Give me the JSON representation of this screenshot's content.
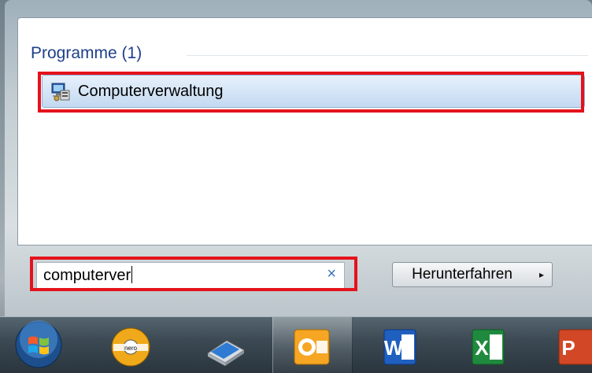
{
  "start_menu": {
    "group_header": "Programme (1)",
    "result_item": {
      "label": "Computerverwaltung",
      "icon": "computer-management-icon"
    }
  },
  "search": {
    "value": "computerver",
    "clear_symbol": "×"
  },
  "shutdown": {
    "label": "Herunterfahren",
    "arrow": "▸"
  },
  "taskbar": {
    "items": [
      {
        "name": "windows-start-orb"
      },
      {
        "name": "nero-icon"
      },
      {
        "name": "scanner-icon"
      },
      {
        "name": "outlook-icon"
      },
      {
        "name": "word-icon"
      },
      {
        "name": "excel-icon"
      },
      {
        "name": "powerpoint-icon"
      }
    ]
  },
  "colors": {
    "highlight_border": "#e4121c",
    "header_text": "#1e3f8a",
    "clear_button": "#3a73b8"
  }
}
